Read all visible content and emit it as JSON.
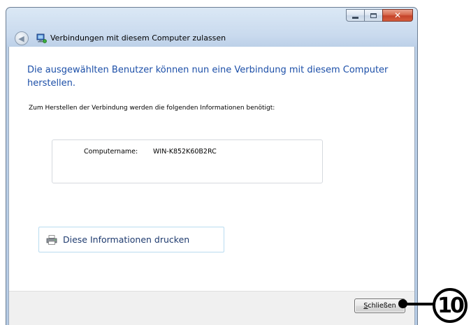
{
  "window": {
    "title": "Verbindungen mit diesem Computer zulassen"
  },
  "icons": {
    "minimize": "minimize-icon",
    "maximize": "maximize-icon",
    "close": "close-icon",
    "back": "back-arrow-icon",
    "title": "network-computer-icon",
    "print": "printer-icon"
  },
  "content": {
    "heading": "Die ausgewählten Benutzer können nun eine Verbindung mit diesem Computer herstellen.",
    "subtext": "Zum Herstellen der Verbindung werden die folgenden Informationen benötigt:",
    "info": {
      "label": "Computername:",
      "value": "WIN-K852K60B2RC"
    },
    "print_link": "Diese Informationen drucken"
  },
  "footer": {
    "close_label_mnemonic": "S",
    "close_label_rest": "chließen"
  },
  "callout": {
    "number": "10"
  },
  "colors": {
    "heading": "#1c4fa8",
    "close_button_red": "#c4432a",
    "footer_bg": "#f0f0f0"
  }
}
